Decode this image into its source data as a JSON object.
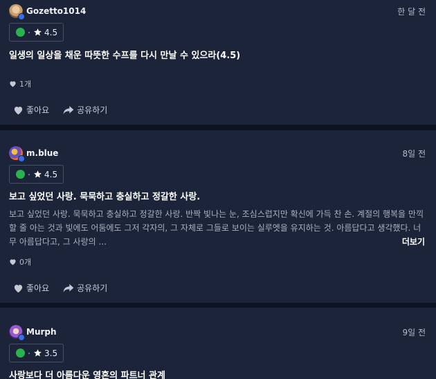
{
  "reviews": [
    {
      "username": "Gozetto1014",
      "date": "한 달 전",
      "rating": "4.5",
      "title": "일생의 일상을 채운 따뜻한 수프를 다시 만날 수 있으라(4.5)",
      "body": "",
      "likes": "1개",
      "like_label": "좋아요",
      "share_label": "공유하기"
    },
    {
      "username": "m.blue",
      "date": "8일 전",
      "rating": "4.5",
      "title": "보고 싶었던 사랑. 묵묵하고 충실하고 정갈한 사랑.",
      "body": "보고 싶었던 사랑. 묵묵하고 충실하고 정갈한 사랑. 반짝 빛나는 눈, 조심스럽지만 확신에 가득 찬 손. 계절의 행복을 만끽할 줄 아는 것과 빛에도 어둠에도 그저 각자의, 그 자체로 그들로 보이는 실루엣을 유지하는 것. 아름답다고 생각했다. 너무 아름답다고, 그 사랑의 ...",
      "more_label": "더보기",
      "likes": "0개",
      "like_label": "좋아요",
      "share_label": "공유하기"
    },
    {
      "username": "Murph",
      "date": "9일 전",
      "rating": "3.5",
      "title": "사랑보다 더 아름다운 영혼의 파트너 관계"
    }
  ],
  "icons": {
    "status_dot": "green-dot-icon",
    "star": "star-icon",
    "heart": "heart-icon",
    "share": "share-arrow-icon",
    "verified": "verified-badge-icon"
  },
  "colors": {
    "background": "#0d1322",
    "card": "#1c2439",
    "status_green": "#28b34e",
    "verified_blue": "#3b6ee8"
  }
}
